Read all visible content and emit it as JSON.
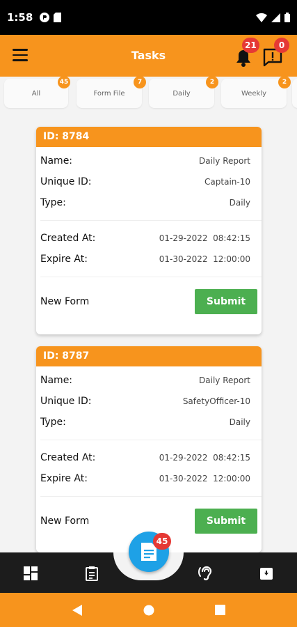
{
  "status_bar": {
    "time": "1:58"
  },
  "app_bar": {
    "title": "Tasks",
    "notifications_count": "21",
    "messages_count": "0"
  },
  "filters": [
    {
      "label": "All",
      "count": "45"
    },
    {
      "label": "Form File",
      "count": "7"
    },
    {
      "label": "Daily",
      "count": "2"
    },
    {
      "label": "Weekly",
      "count": "2"
    }
  ],
  "labels": {
    "name": "Name:",
    "unique_id": "Unique ID:",
    "type": "Type:",
    "created_at": "Created At:",
    "expire_at": "Expire At:",
    "new_form": "New Form",
    "submit": "Submit"
  },
  "tasks": [
    {
      "id": "ID: 8784",
      "name": "Daily Report",
      "unique_id": "Captain-10",
      "type": "Daily",
      "created_at": "01-29-2022  08:42:15",
      "expire_at": "01-30-2022  12:00:00"
    },
    {
      "id": "ID: 8787",
      "name": "Daily Report",
      "unique_id": "SafetyOfficer-10",
      "type": "Daily",
      "created_at": "01-29-2022  08:42:15",
      "expire_at": "01-30-2022  12:00:00"
    }
  ],
  "fab": {
    "count": "45"
  },
  "colors": {
    "accent": "#f7941d",
    "submit": "#4caf50",
    "fab": "#1ea1e6",
    "badge": "#e53935"
  }
}
